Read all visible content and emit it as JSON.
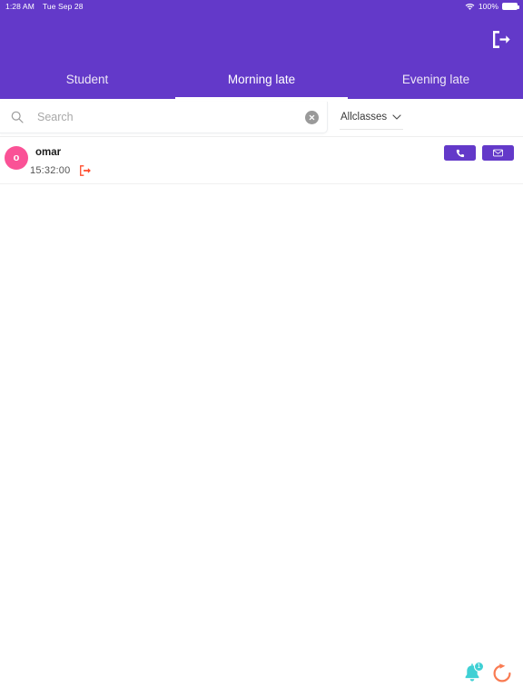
{
  "statusbar": {
    "time": "1:28 AM",
    "date": "Tue Sep 28",
    "battery_percent": "100%",
    "wifi_icon": "wifi-icon",
    "battery_icon": "battery-icon"
  },
  "appbar": {
    "logout_icon": "logout-icon",
    "background_color": "#6339C9"
  },
  "tabs": {
    "active_index": 1,
    "items": [
      {
        "label": "Student"
      },
      {
        "label": "Morning late"
      },
      {
        "label": "Evening late"
      }
    ]
  },
  "search": {
    "placeholder": "Search",
    "value": "",
    "search_icon": "search-icon",
    "clear_icon": "clear-icon"
  },
  "class_filter": {
    "label": "Allclasses",
    "chevron_icon": "chevron-down-icon"
  },
  "students": [
    {
      "initial": "o",
      "name": "omar",
      "time": "15:32:00",
      "status_icon": "exit-icon",
      "avatar_color": "#FA5296",
      "status_color": "#FF4B2B",
      "call_icon": "phone-icon",
      "mail_icon": "mail-icon"
    }
  ],
  "floating": {
    "notification_icon": "bell-icon",
    "notification_count": "1",
    "refresh_icon": "refresh-icon",
    "notification_color": "#3FD0D4",
    "refresh_color": "#F97B52"
  }
}
